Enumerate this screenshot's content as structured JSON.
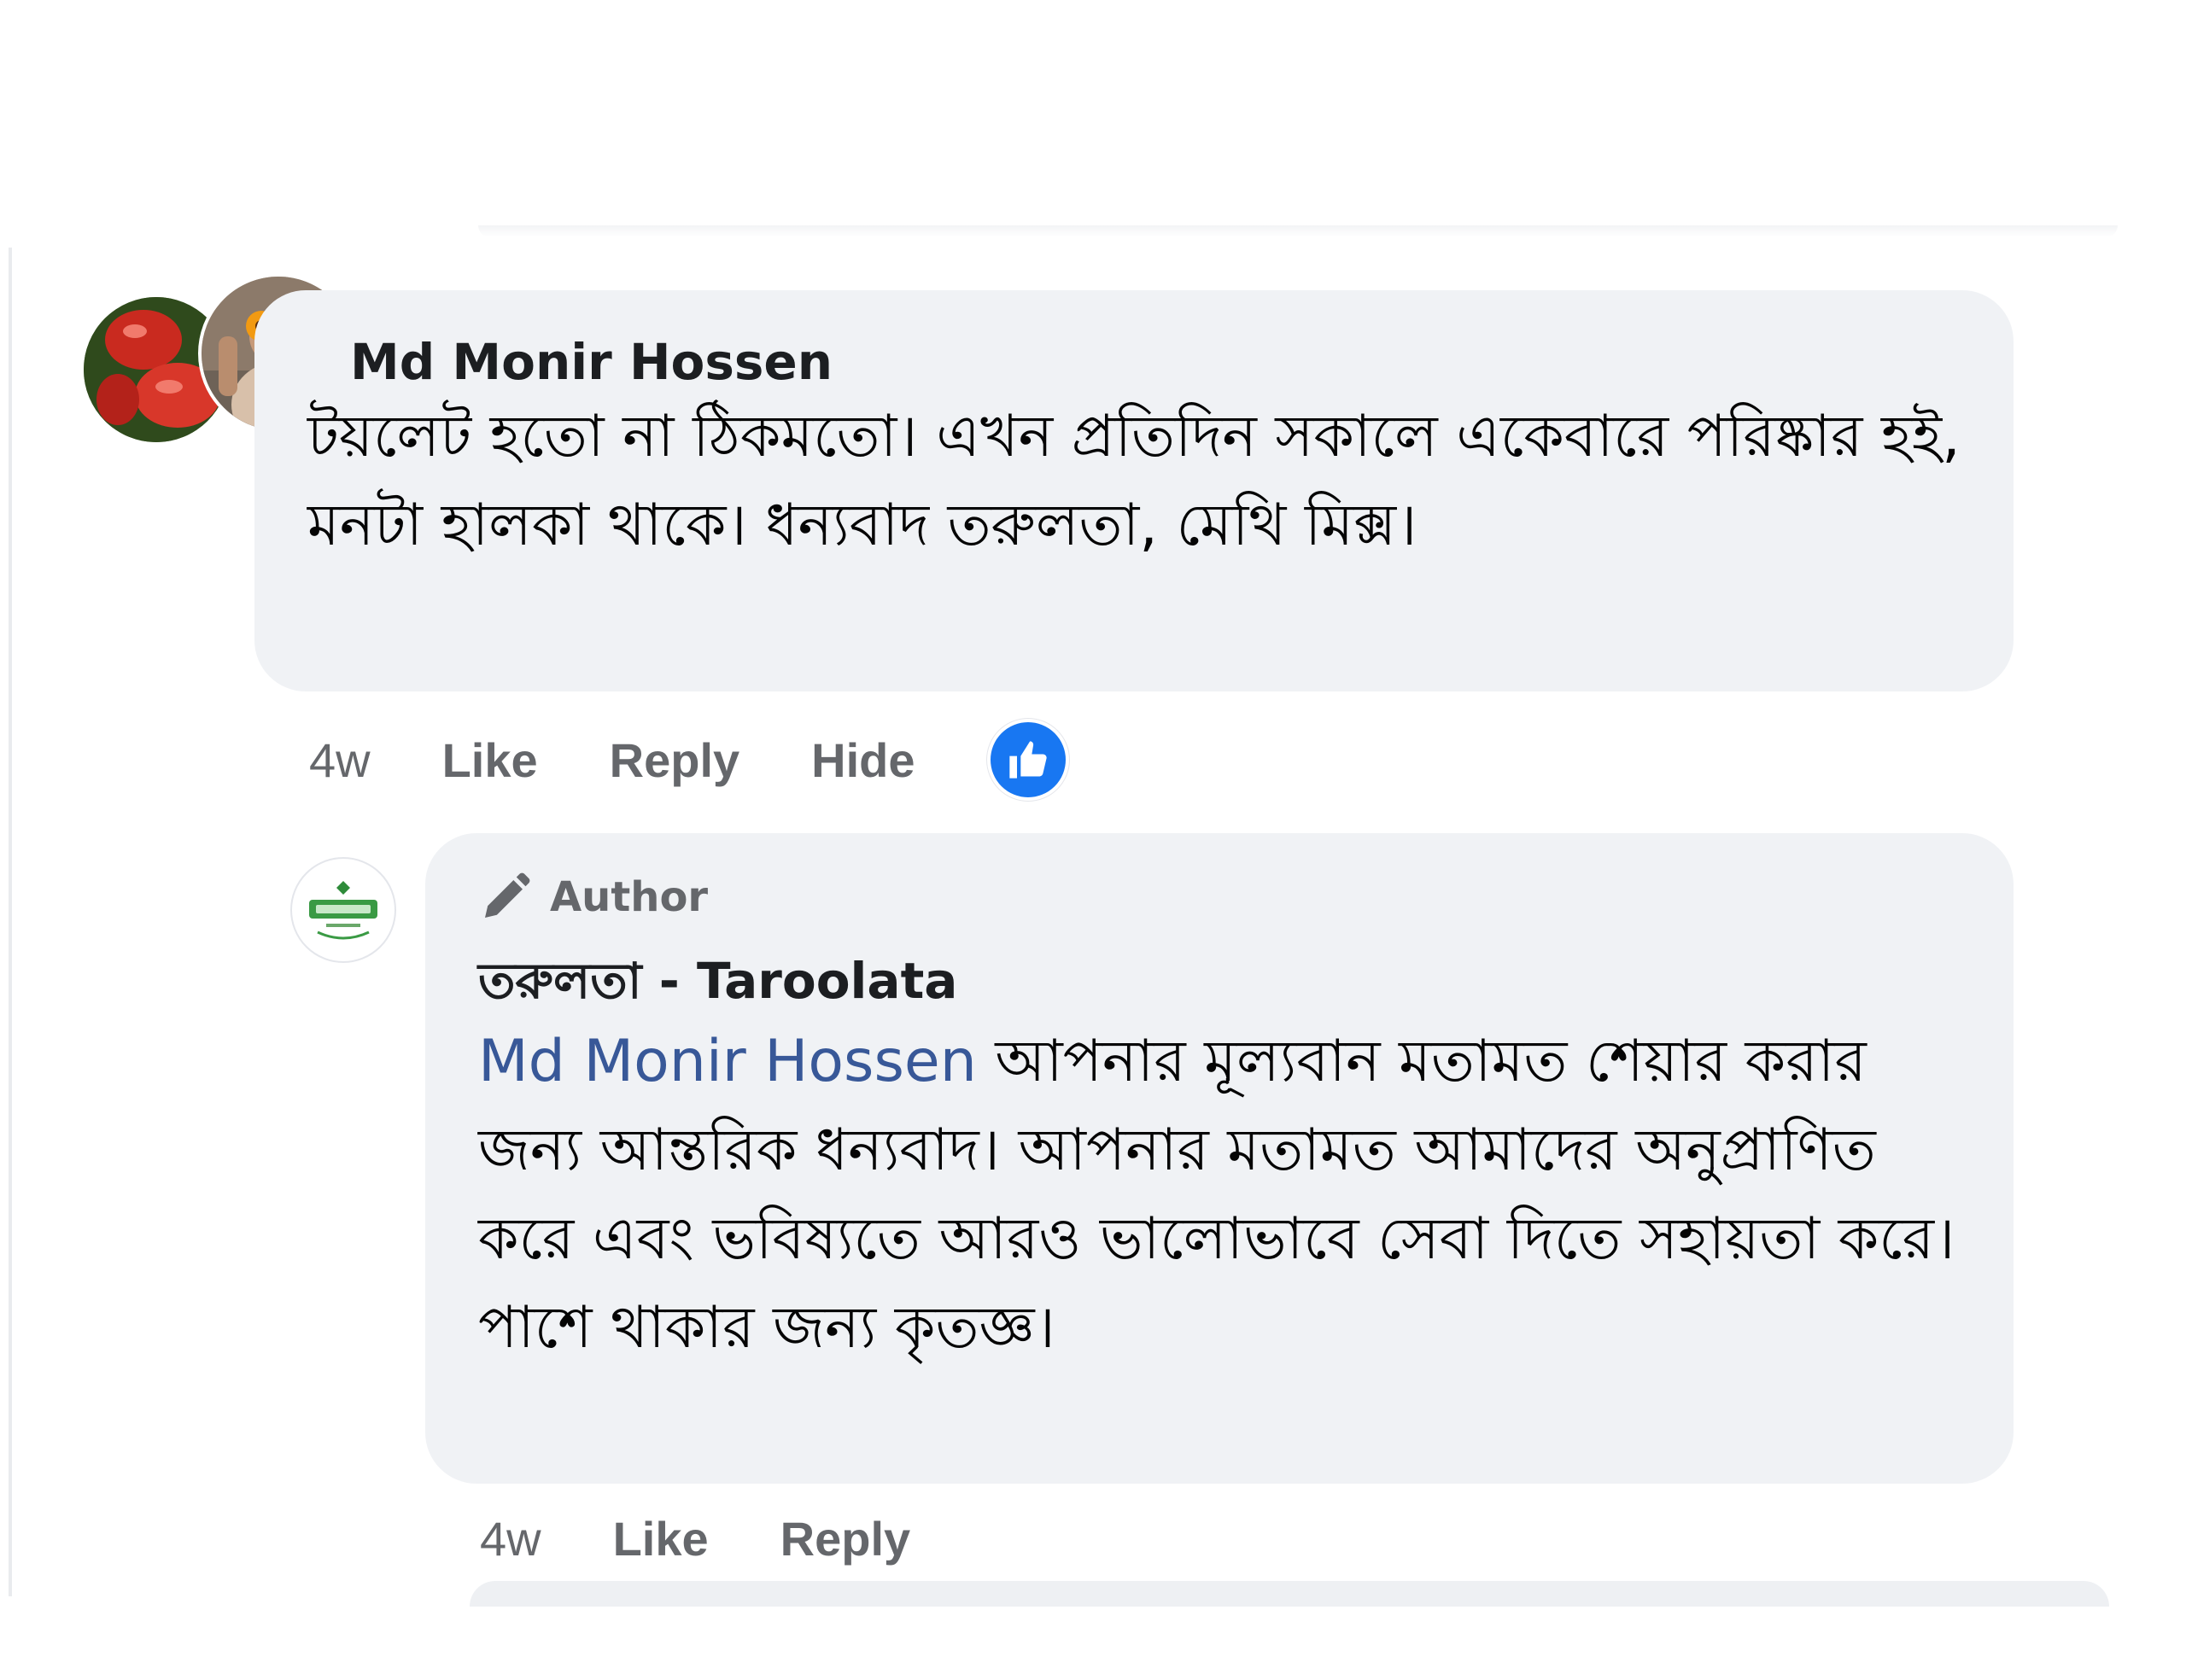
{
  "comment": {
    "author_name": "Md Monir Hossen",
    "text": "টয়লেট হতো না ঠিকমতো। এখন প্রতিদিন সকালে একেবারে পরিষ্কার হই, মনটা হালকা থাকে। ধন্যবাদ তরুলতা, মেথি মিক্স।",
    "actions": {
      "time": "4w",
      "like": "Like",
      "reply": "Reply",
      "hide": "Hide"
    },
    "reaction_icon": "like-thumb-icon",
    "reaction_color": "#1877f2"
  },
  "reply": {
    "badge_label": "Author",
    "badge_icon": "pencil-icon",
    "page_name": "তরুলতা - Taroolata",
    "mention": "Md Monir Hossen",
    "text": " আপনার মূল্যবান মতামত শেয়ার করার জন্য আন্তরিক ধন্যবাদ। আপনার মতামত আমাদের অনুপ্রাণিত করে এবং ভবিষ্যতে আরও ভালোভাবে সেবা দিতে সহায়তা করে। পাশে থাকার জন্য কৃতজ্ঞ।",
    "actions": {
      "time": "4w",
      "like": "Like",
      "reply": "Reply"
    },
    "mention_color": "#385898"
  },
  "colors": {
    "bubble_bg": "#f0f2f5",
    "secondary_text": "#65676b",
    "primary_text": "#050505"
  }
}
